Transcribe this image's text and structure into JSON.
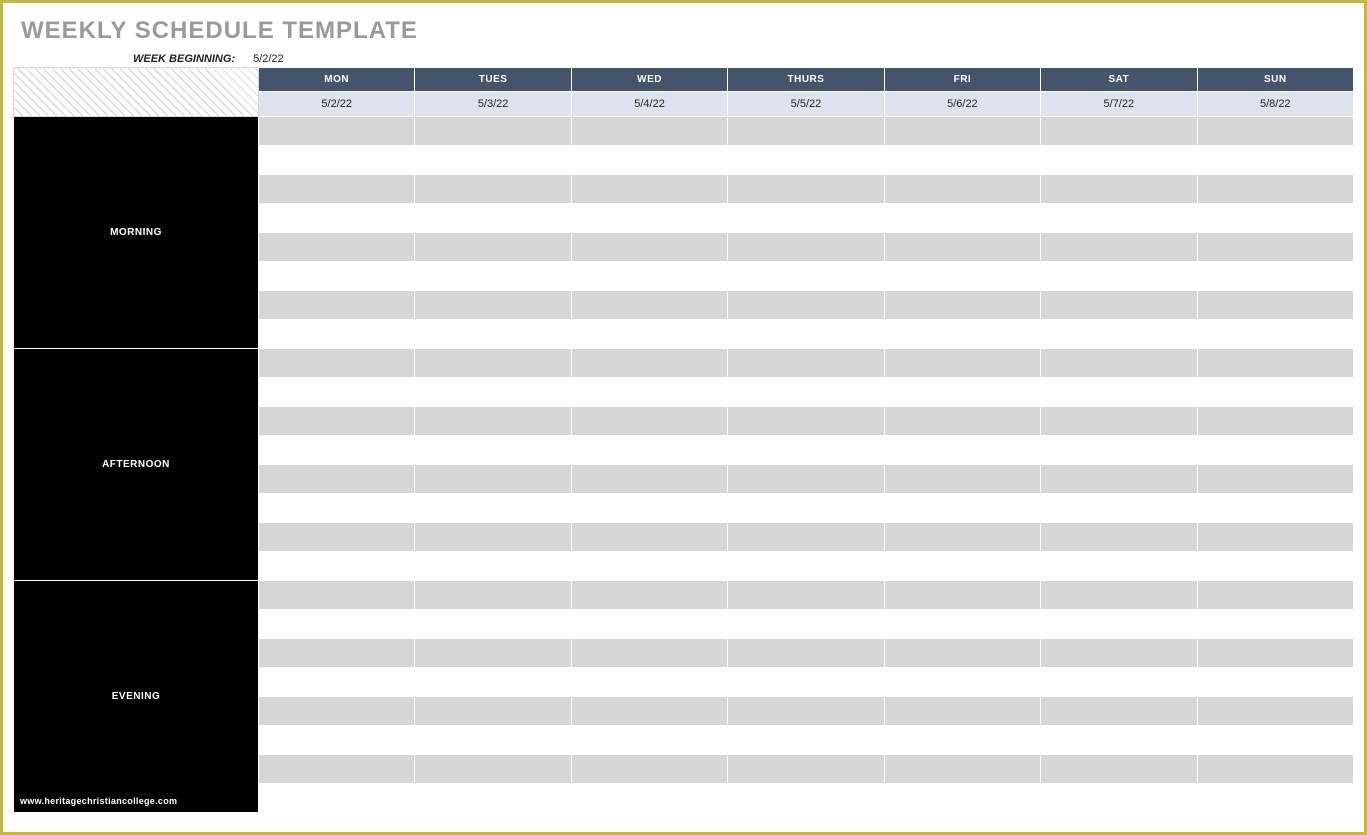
{
  "title": "WEEKLY SCHEDULE TEMPLATE",
  "week_beginning_label": "WEEK BEGINNING:",
  "week_beginning_value": "5/2/22",
  "days": [
    "MON",
    "TUES",
    "WED",
    "THURS",
    "FRI",
    "SAT",
    "SUN"
  ],
  "dates": [
    "5/2/22",
    "5/3/22",
    "5/4/22",
    "5/5/22",
    "5/6/22",
    "5/7/22",
    "5/8/22"
  ],
  "periods": [
    {
      "label": "MORNING",
      "rows": 8
    },
    {
      "label": "AFTERNOON",
      "rows": 8
    },
    {
      "label": "EVENING",
      "rows": 8
    }
  ],
  "watermark": "www.heritagechristiancollege.com"
}
